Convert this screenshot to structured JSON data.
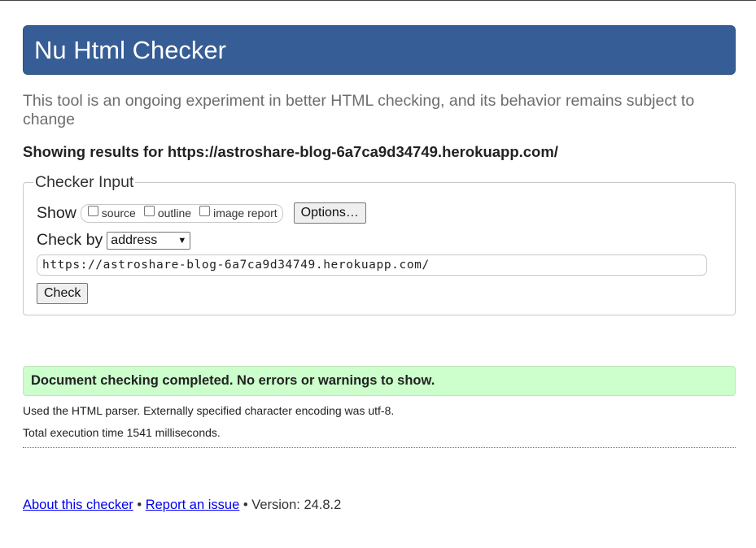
{
  "header": {
    "title": "Nu Html Checker"
  },
  "intro": "This tool is an ongoing experiment in better HTML checking, and its behavior remains subject to change",
  "results": {
    "prefix": "Showing results for ",
    "url": "https://astroshare-blog-6a7ca9d34749.herokuapp.com/"
  },
  "checker_input": {
    "legend": "Checker Input",
    "show_label": "Show",
    "options": [
      {
        "label": "source",
        "checked": false
      },
      {
        "label": "outline",
        "checked": false
      },
      {
        "label": "image report",
        "checked": false
      }
    ],
    "options_button": "Options…",
    "check_by_label": "Check by",
    "check_by_value": "address",
    "url_value": "https://astroshare-blog-6a7ca9d34749.herokuapp.com/",
    "check_button": "Check"
  },
  "status": {
    "message": "Document checking completed. No errors or warnings to show.",
    "color": "#ccffcc"
  },
  "details": {
    "parser": "Used the HTML parser. Externally specified character encoding was utf-8.",
    "timing": "Total execution time 1541 milliseconds."
  },
  "footer": {
    "about_link": "About this checker",
    "separator": " • ",
    "report_link": "Report an issue",
    "version": "Version: 24.8.2"
  },
  "colors": {
    "banner": "#365d95",
    "link": "#0000ee"
  }
}
